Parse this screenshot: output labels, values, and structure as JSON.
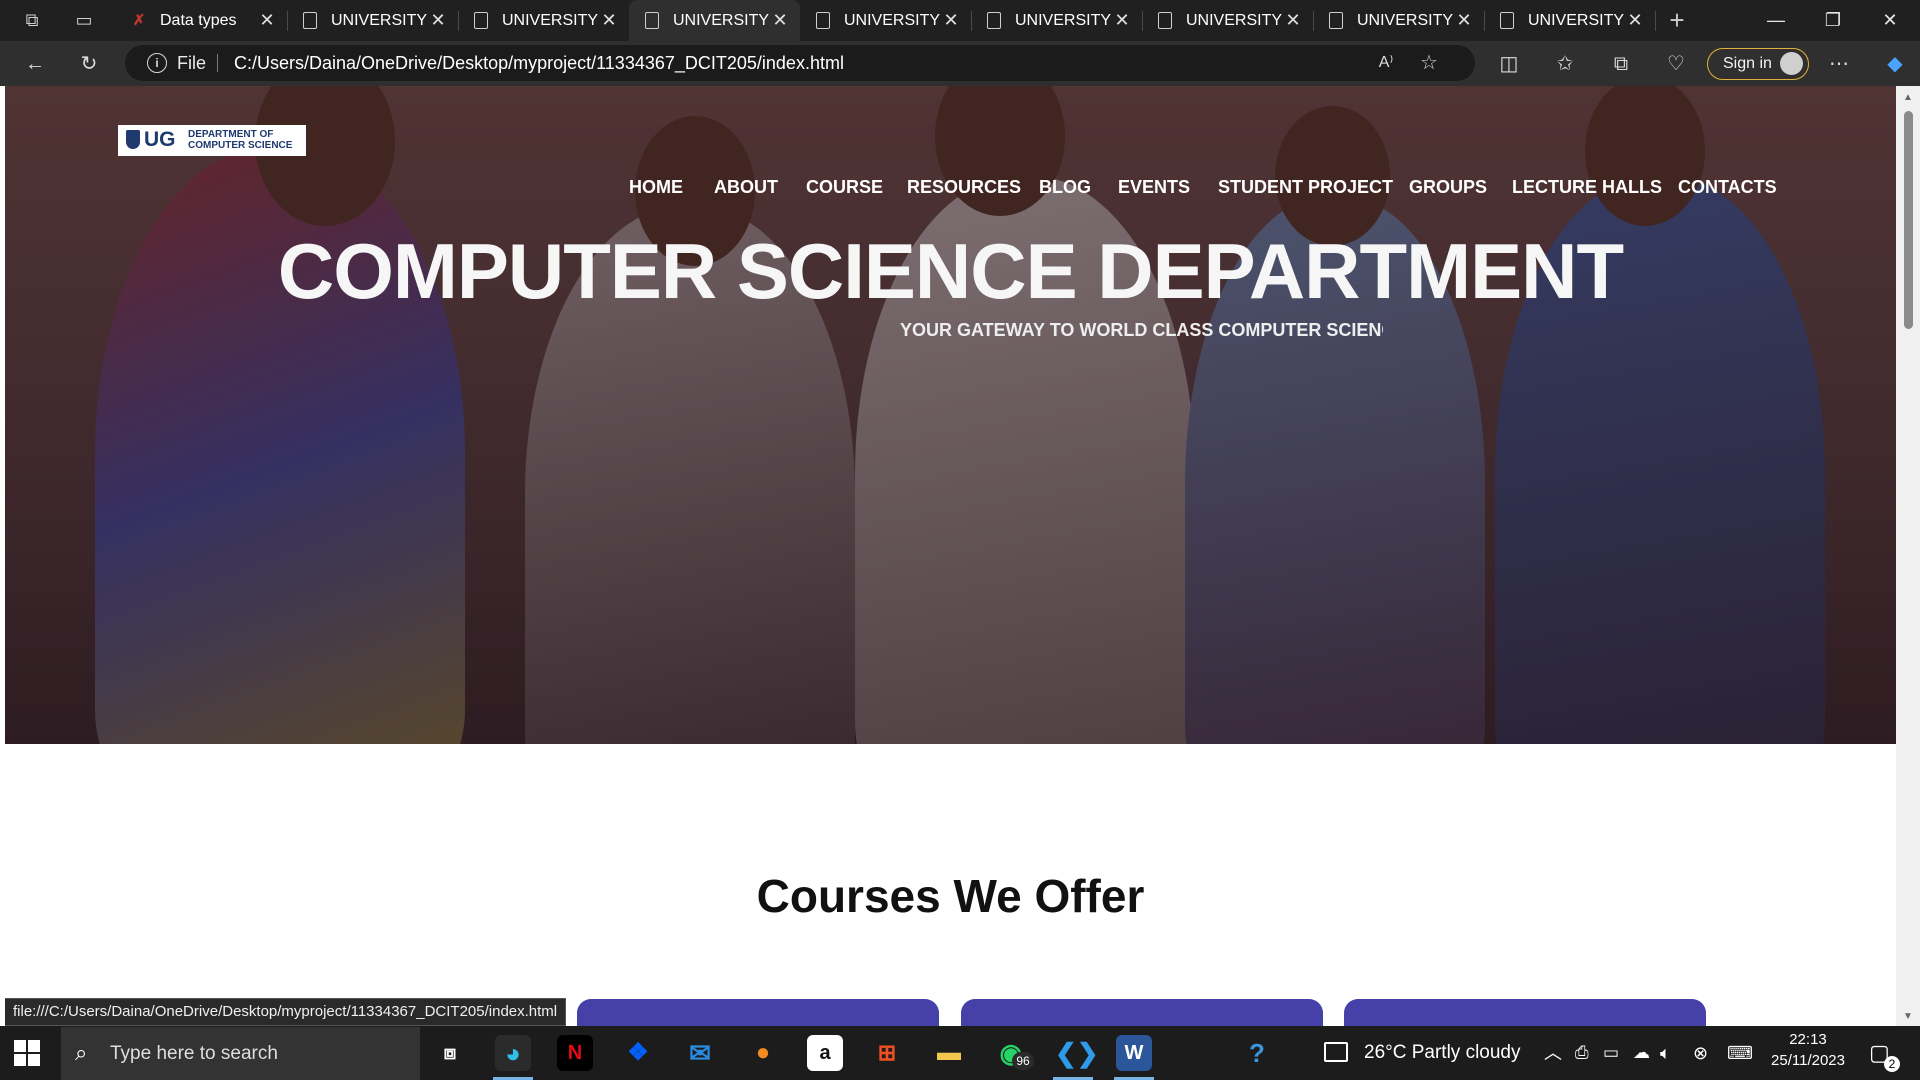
{
  "browser": {
    "tabs": [
      {
        "label": "Data types",
        "icon": "red-x-icon",
        "active": false
      },
      {
        "label": "UNIVERSITY OF GHANA",
        "icon": "page-icon",
        "active": false
      },
      {
        "label": "UNIVERSITY OF GHANA",
        "icon": "page-icon",
        "active": false
      },
      {
        "label": "UNIVERSITY OF GHANA",
        "icon": "page-icon",
        "active": true
      },
      {
        "label": "UNIVERSITY OF GHANA",
        "icon": "page-icon",
        "active": false
      },
      {
        "label": "UNIVERSITY OF GHANA",
        "icon": "page-icon",
        "active": false
      },
      {
        "label": "UNIVERSITY OF GHANA",
        "icon": "page-icon",
        "active": false
      },
      {
        "label": "UNIVERSITY OF GHANA",
        "icon": "page-icon",
        "active": false
      },
      {
        "label": "UNIVERSITY OF GHANA",
        "icon": "page-icon",
        "active": false
      }
    ],
    "address": {
      "scheme_label": "File",
      "url": "C:/Users/Daina/OneDrive/Desktop/myproject/11334367_DCIT205/index.html"
    },
    "signin_label": "Sign in",
    "status_url": "file:///C:/Users/Daina/OneDrive/Desktop/myproject/11334367_DCIT205/index.html",
    "accent_color": "#e0b23b"
  },
  "page": {
    "logo": {
      "short": "UG",
      "line1": "DEPARTMENT OF",
      "line2": "COMPUTER SCIENCE"
    },
    "nav": [
      "HOME",
      "ABOUT",
      "COURSE",
      "RESOURCES",
      "BLOG",
      "EVENTS",
      "STUDENT PROJECT",
      "GROUPS",
      "LECTURE HALLS",
      "CONTACTS"
    ],
    "hero_title": "COMPUTER SCIENCE DEPARTMENT",
    "hero_subtitle": "YOUR GATEWAY TO WORLD CLASS COMPUTER SCIENCE",
    "courses_title": "Courses We Offer",
    "card_color": "#4541a8"
  },
  "taskbar": {
    "search_placeholder": "Type here to search",
    "whatsapp_badge": "96",
    "weather": "26°C  Partly cloudy",
    "time": "22:13",
    "date": "25/11/2023",
    "notification_count": "2"
  }
}
